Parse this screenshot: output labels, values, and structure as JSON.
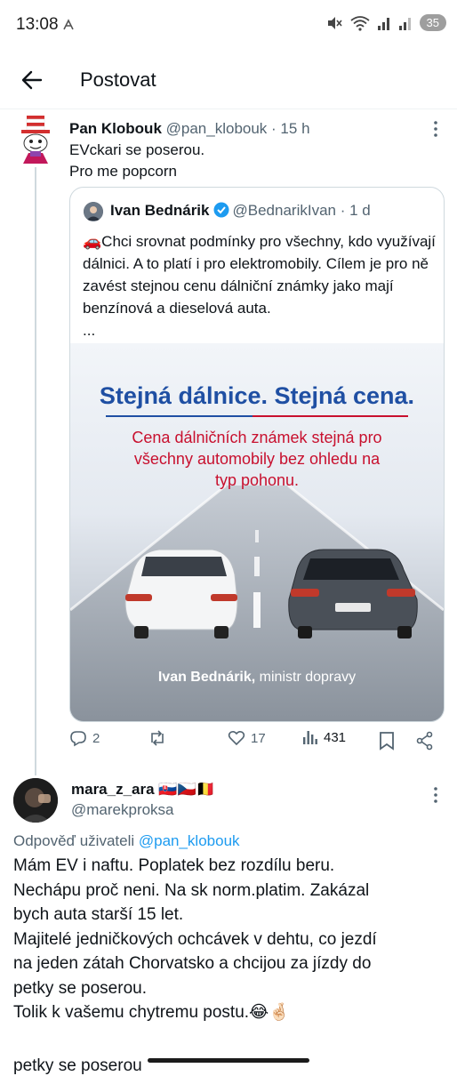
{
  "status_bar": {
    "time": "13:08",
    "battery": "35"
  },
  "header": {
    "title": "Postovat"
  },
  "tweet1": {
    "name": "Pan Klobouk",
    "handle": "@pan_klobouk",
    "time": "· 15 h",
    "lines": [
      "EVckari se poserou.",
      "Pro me popcorn"
    ]
  },
  "quote": {
    "name": "Ivan Bednárik",
    "handle": "@BednarikIvan",
    "time": "· 1 d",
    "text": "🚗Chci srovnat podmínky pro všechny, kdo využívají dálnici. A to platí i pro elektromobily. Cílem je pro ně zavést stejnou cenu dálniční známky jako mají benzínová a dieselová auta.",
    "ellipsis": "...",
    "image": {
      "headline": "Stejná dálnice. Stejná cena.",
      "sub_lines": [
        "Cena dálničních známek stejná pro",
        "všechny automobily bez ohledu na",
        "typ pohonu."
      ],
      "caption_name": "Ivan Bednárik,",
      "caption_role": " ministr dopravy"
    }
  },
  "actions": {
    "replies": "2",
    "retweets": "",
    "likes": "17",
    "views": "431"
  },
  "tweet2": {
    "name": "mara_z_ara 🇸🇰🇨🇿🇧🇪",
    "handle": "@marekproksa",
    "reply_prefix": "Odpověď uživateli ",
    "reply_handle": "@pan_klobouk",
    "lines": [
      "Mám EV i naftu. Poplatek bez rozdílu beru.",
      "Nechápu proč neni. Na sk norm.platim. Zakázal",
      "bych auta starší 15 let.",
      "Majitelé jedničkových ochcávek v dehtu, co jezdí",
      "na jeden zátah Chorvatsko a chcijou za jízdy  do",
      "petky se poserou.",
      "Tolik k vašemu chytremu postu.😂🤞🏻"
    ],
    "cut_line": "petky se poserou"
  },
  "colors": {
    "accent": "#1d9bf0",
    "muted": "#536471",
    "border": "#cfd9de",
    "headline": "#1f4fa3",
    "sub": "#c8102e"
  }
}
